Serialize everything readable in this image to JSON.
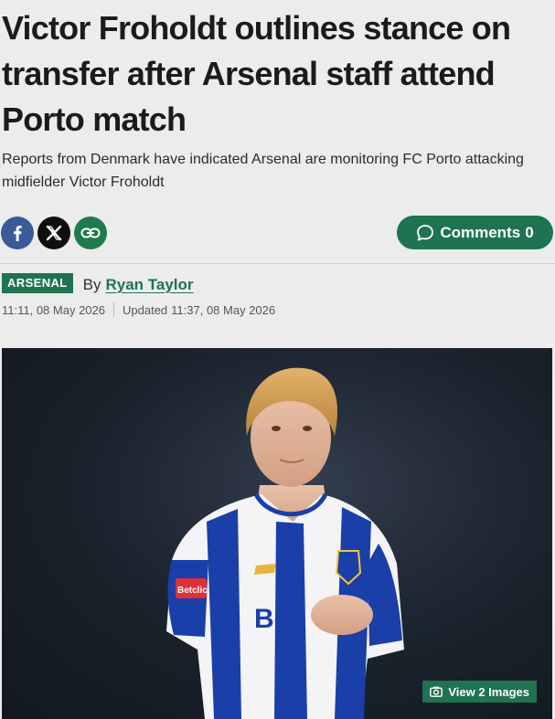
{
  "article": {
    "headline": "Victor Froholdt outlines stance on transfer after Arsenal staff attend Porto match",
    "standfirst": "Reports from Denmark have indicated Arsenal are monitoring FC Porto attacking midfielder Victor Froholdt",
    "section": "ARSENAL",
    "by_prefix": "By",
    "author": "Ryan Taylor",
    "published": "11:11, 08 May 2026",
    "updated_prefix": "Updated",
    "updated": "11:37, 08 May 2026"
  },
  "share": {
    "facebook_icon": "facebook-icon",
    "x_icon": "x-icon",
    "link_icon": "link-icon"
  },
  "comments": {
    "label": "Comments",
    "count": "0",
    "icon": "speech-bubble-icon"
  },
  "hero": {
    "shirt_text": "Bet",
    "sleeve_text": "Betclic",
    "view_images_label": "View 2 Images",
    "view_images_icon": "camera-icon"
  },
  "colors": {
    "brand_green": "#1f7350",
    "facebook_blue": "#3b5a99",
    "x_black": "#0f0f0f",
    "porto_blue": "#1b3fa8"
  }
}
